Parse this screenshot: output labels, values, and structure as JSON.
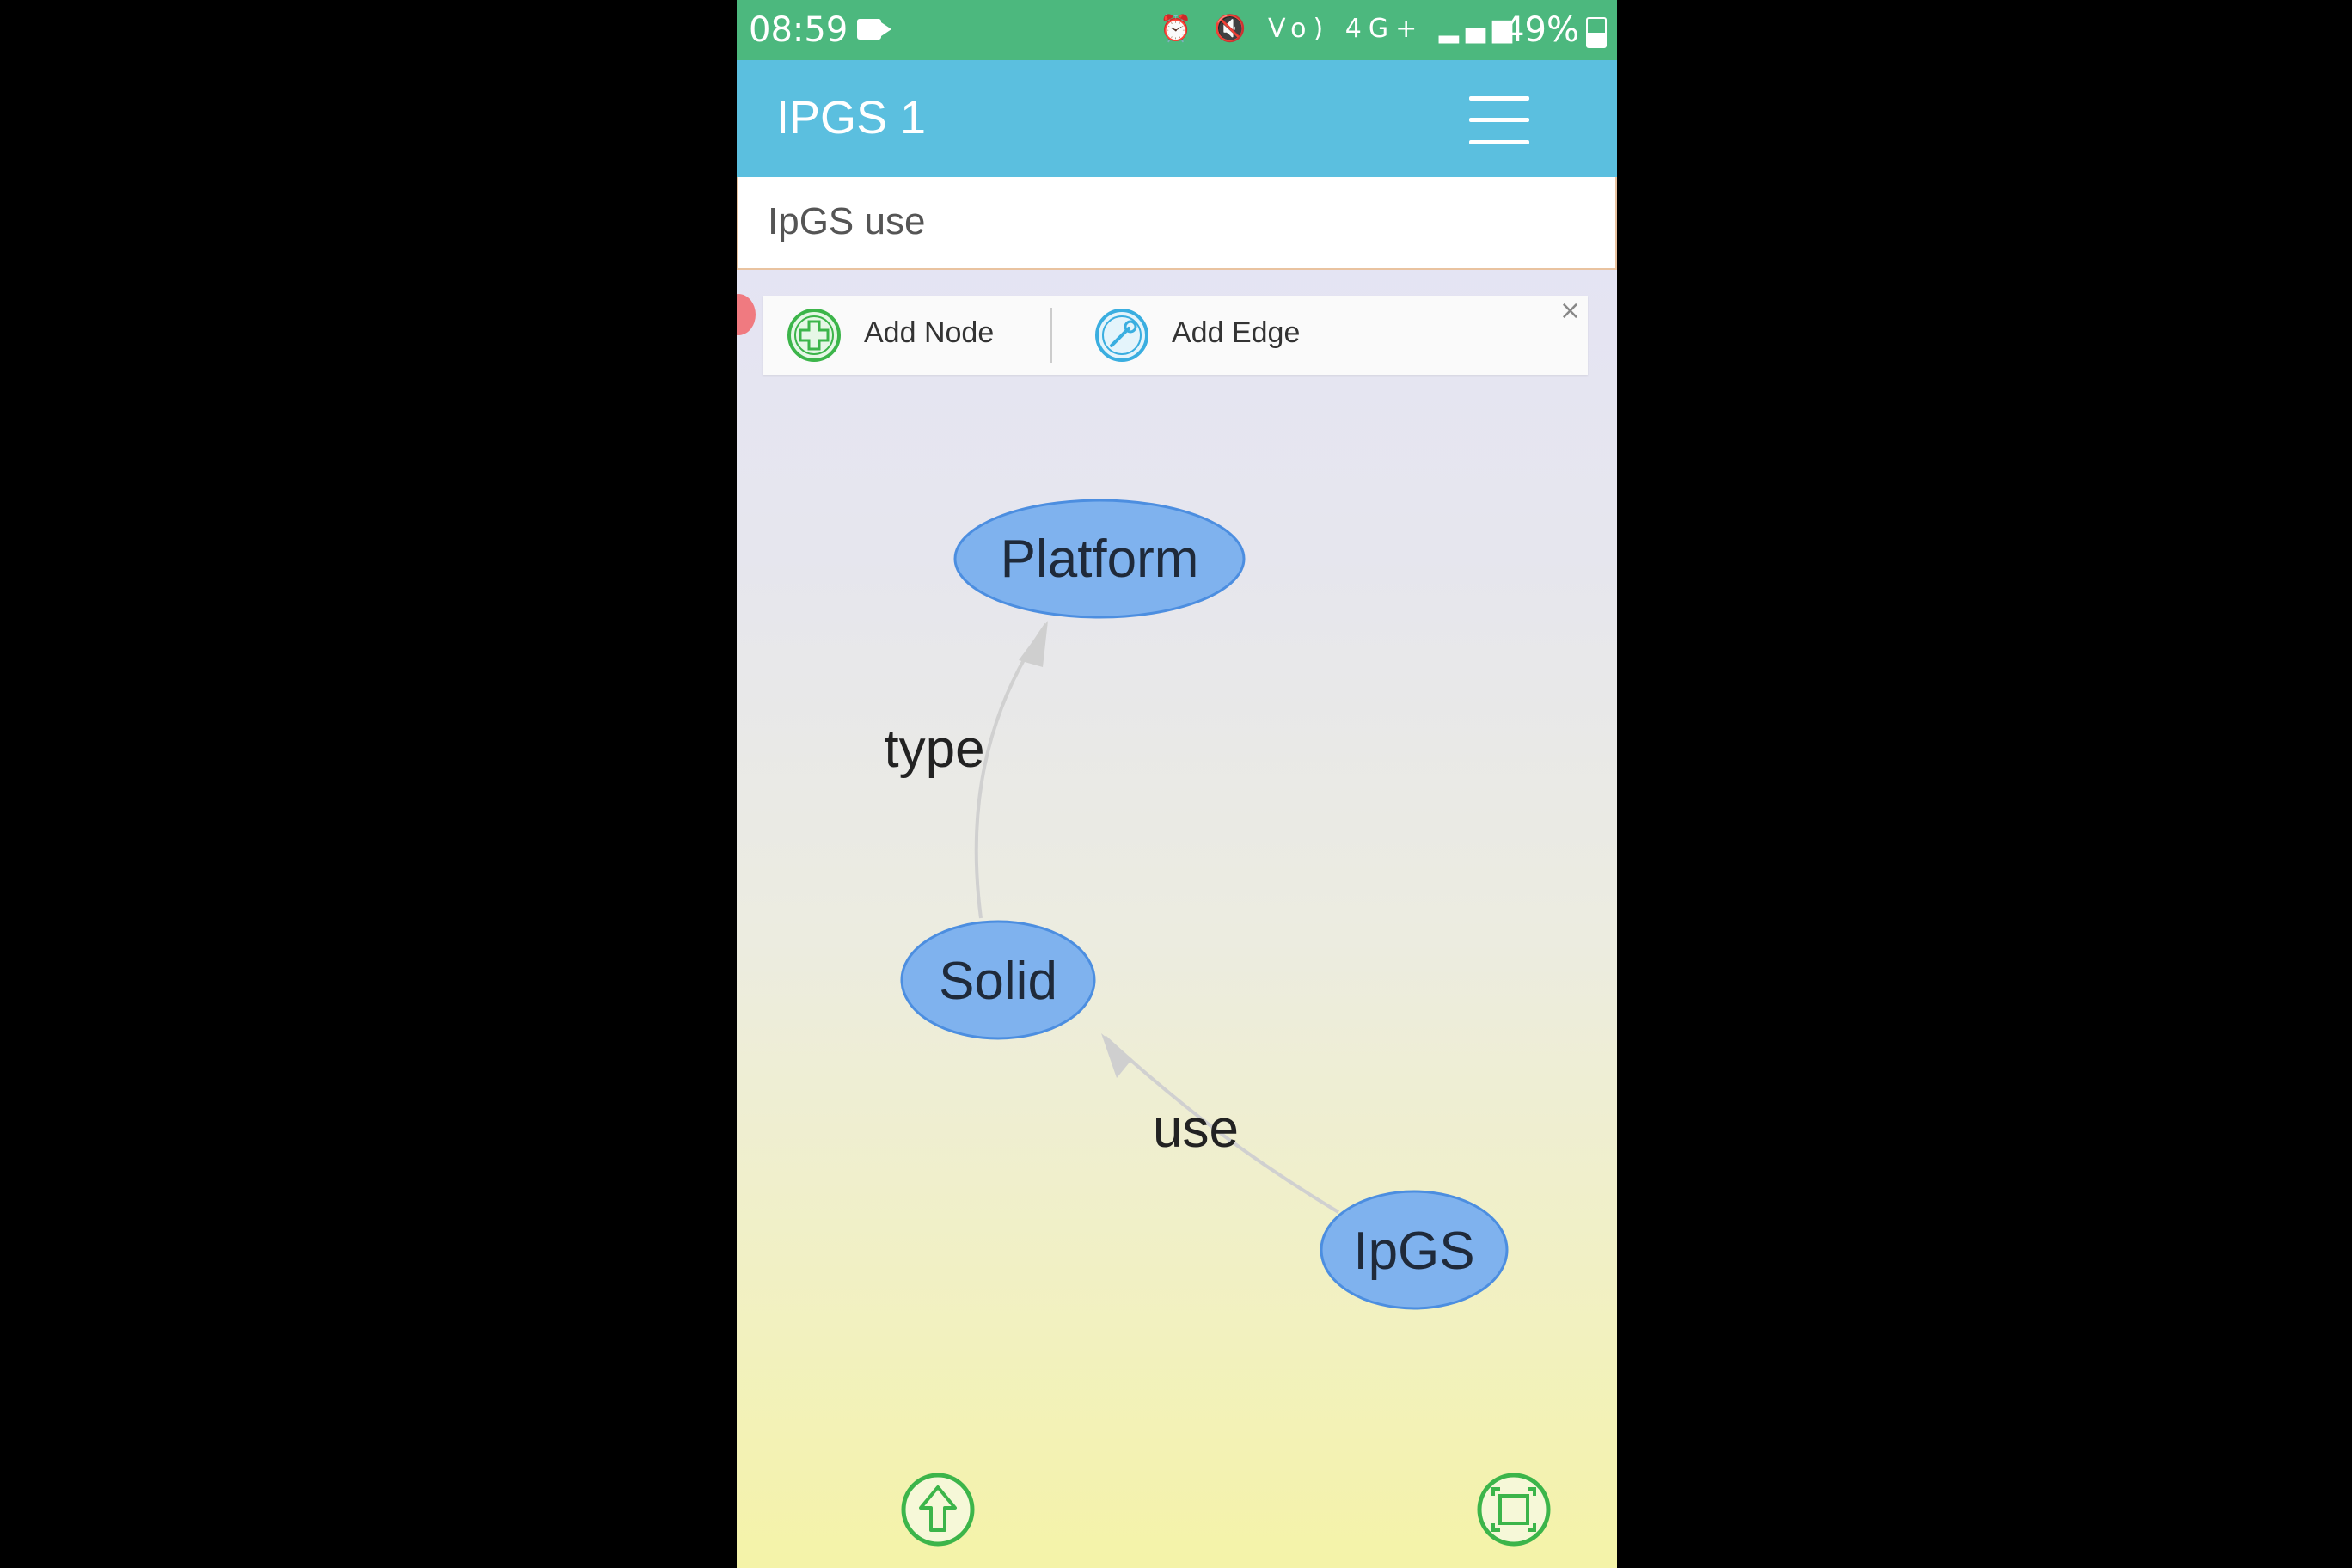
{
  "status_bar": {
    "time": "08:59",
    "icons": "⏰ 🔇 Vo) 4G+ ▂▄▆",
    "battery": "49%"
  },
  "app_bar": {
    "title": "IPGS 1"
  },
  "query": {
    "value": "IpGS use"
  },
  "toolbar": {
    "add_node_label": "Add Node",
    "add_edge_label": "Add Edge",
    "close_glyph": "×"
  },
  "graph": {
    "nodes": [
      {
        "id": "platform",
        "label": "Platform"
      },
      {
        "id": "solid",
        "label": "Solid"
      },
      {
        "id": "ipgs",
        "label": "IpGS"
      }
    ],
    "edges": [
      {
        "from": "solid",
        "to": "platform",
        "label": "type"
      },
      {
        "from": "ipgs",
        "to": "solid",
        "label": "use"
      }
    ]
  },
  "colors": {
    "status_bar": "#4cb87e",
    "app_bar": "#5bbfdf",
    "node_fill": "#7fb2ee",
    "node_stroke": "#4c8ee0",
    "icon_green": "#3cb54a",
    "icon_blue": "#3aaee0"
  }
}
